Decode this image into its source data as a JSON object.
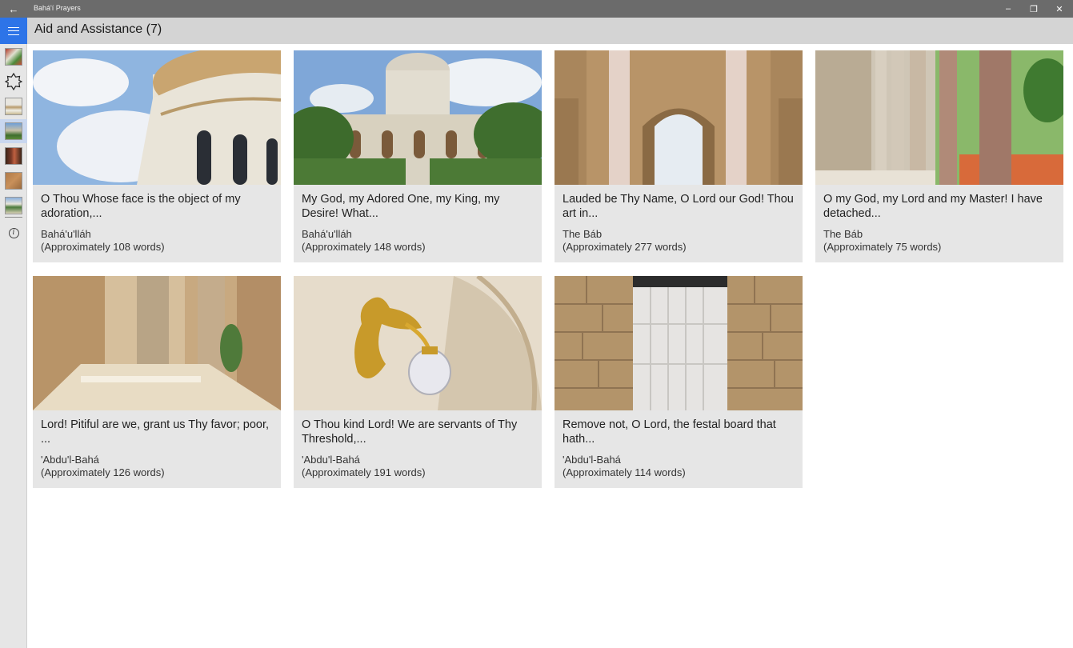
{
  "window": {
    "title": "Bahá'í Prayers",
    "back_glyph": "←",
    "minimize_glyph": "–",
    "restore_glyph": "❐",
    "close_glyph": "✕"
  },
  "header": {
    "title": "Aid and Assistance (7)"
  },
  "sidebar": {
    "items": [
      {
        "icon": "flowers-thumbnail-icon"
      },
      {
        "icon": "star-outline-icon"
      },
      {
        "icon": "shrine-thumbnail-icon"
      },
      {
        "icon": "gardens-thumbnail-icon",
        "selected": true
      },
      {
        "icon": "doorway-thumbnail-icon"
      },
      {
        "icon": "stone-thumbnail-icon"
      },
      {
        "icon": "terrace-thumbnail-icon"
      },
      {
        "icon": "info-icon"
      }
    ]
  },
  "cards": [
    {
      "title": "O Thou Whose face is the object of my adoration,...",
      "author": "Bahá'u'lláh",
      "words": "(Approximately 108 words)"
    },
    {
      "title": "My God, my Adored One, my King, my Desire! What...",
      "author": "Bahá'u'lláh",
      "words": "(Approximately 148 words)"
    },
    {
      "title": "Lauded be Thy Name, O Lord our God! Thou art in...",
      "author": "The Báb",
      "words": "(Approximately 277 words)"
    },
    {
      "title": "O my God, my Lord and my Master! I have detached...",
      "author": "The Báb",
      "words": "(Approximately 75 words)"
    },
    {
      "title": "Lord! Pitiful are we, grant us Thy favor; poor, ...",
      "author": "'Abdu'l-Bahá",
      "words": "(Approximately 126 words)"
    },
    {
      "title": "O Thou kind Lord! We are servants of Thy Threshold,...",
      "author": "'Abdu'l-Bahá",
      "words": "(Approximately 191 words)"
    },
    {
      "title": "Remove not, O Lord, the festal board that hath...",
      "author": "'Abdu'l-Bahá",
      "words": "(Approximately 114 words)"
    }
  ],
  "colors": {
    "accent": "#2d74e8",
    "titlebar": "#6b6b6b",
    "header": "#d4d4d4",
    "card": "#e6e6e6"
  }
}
